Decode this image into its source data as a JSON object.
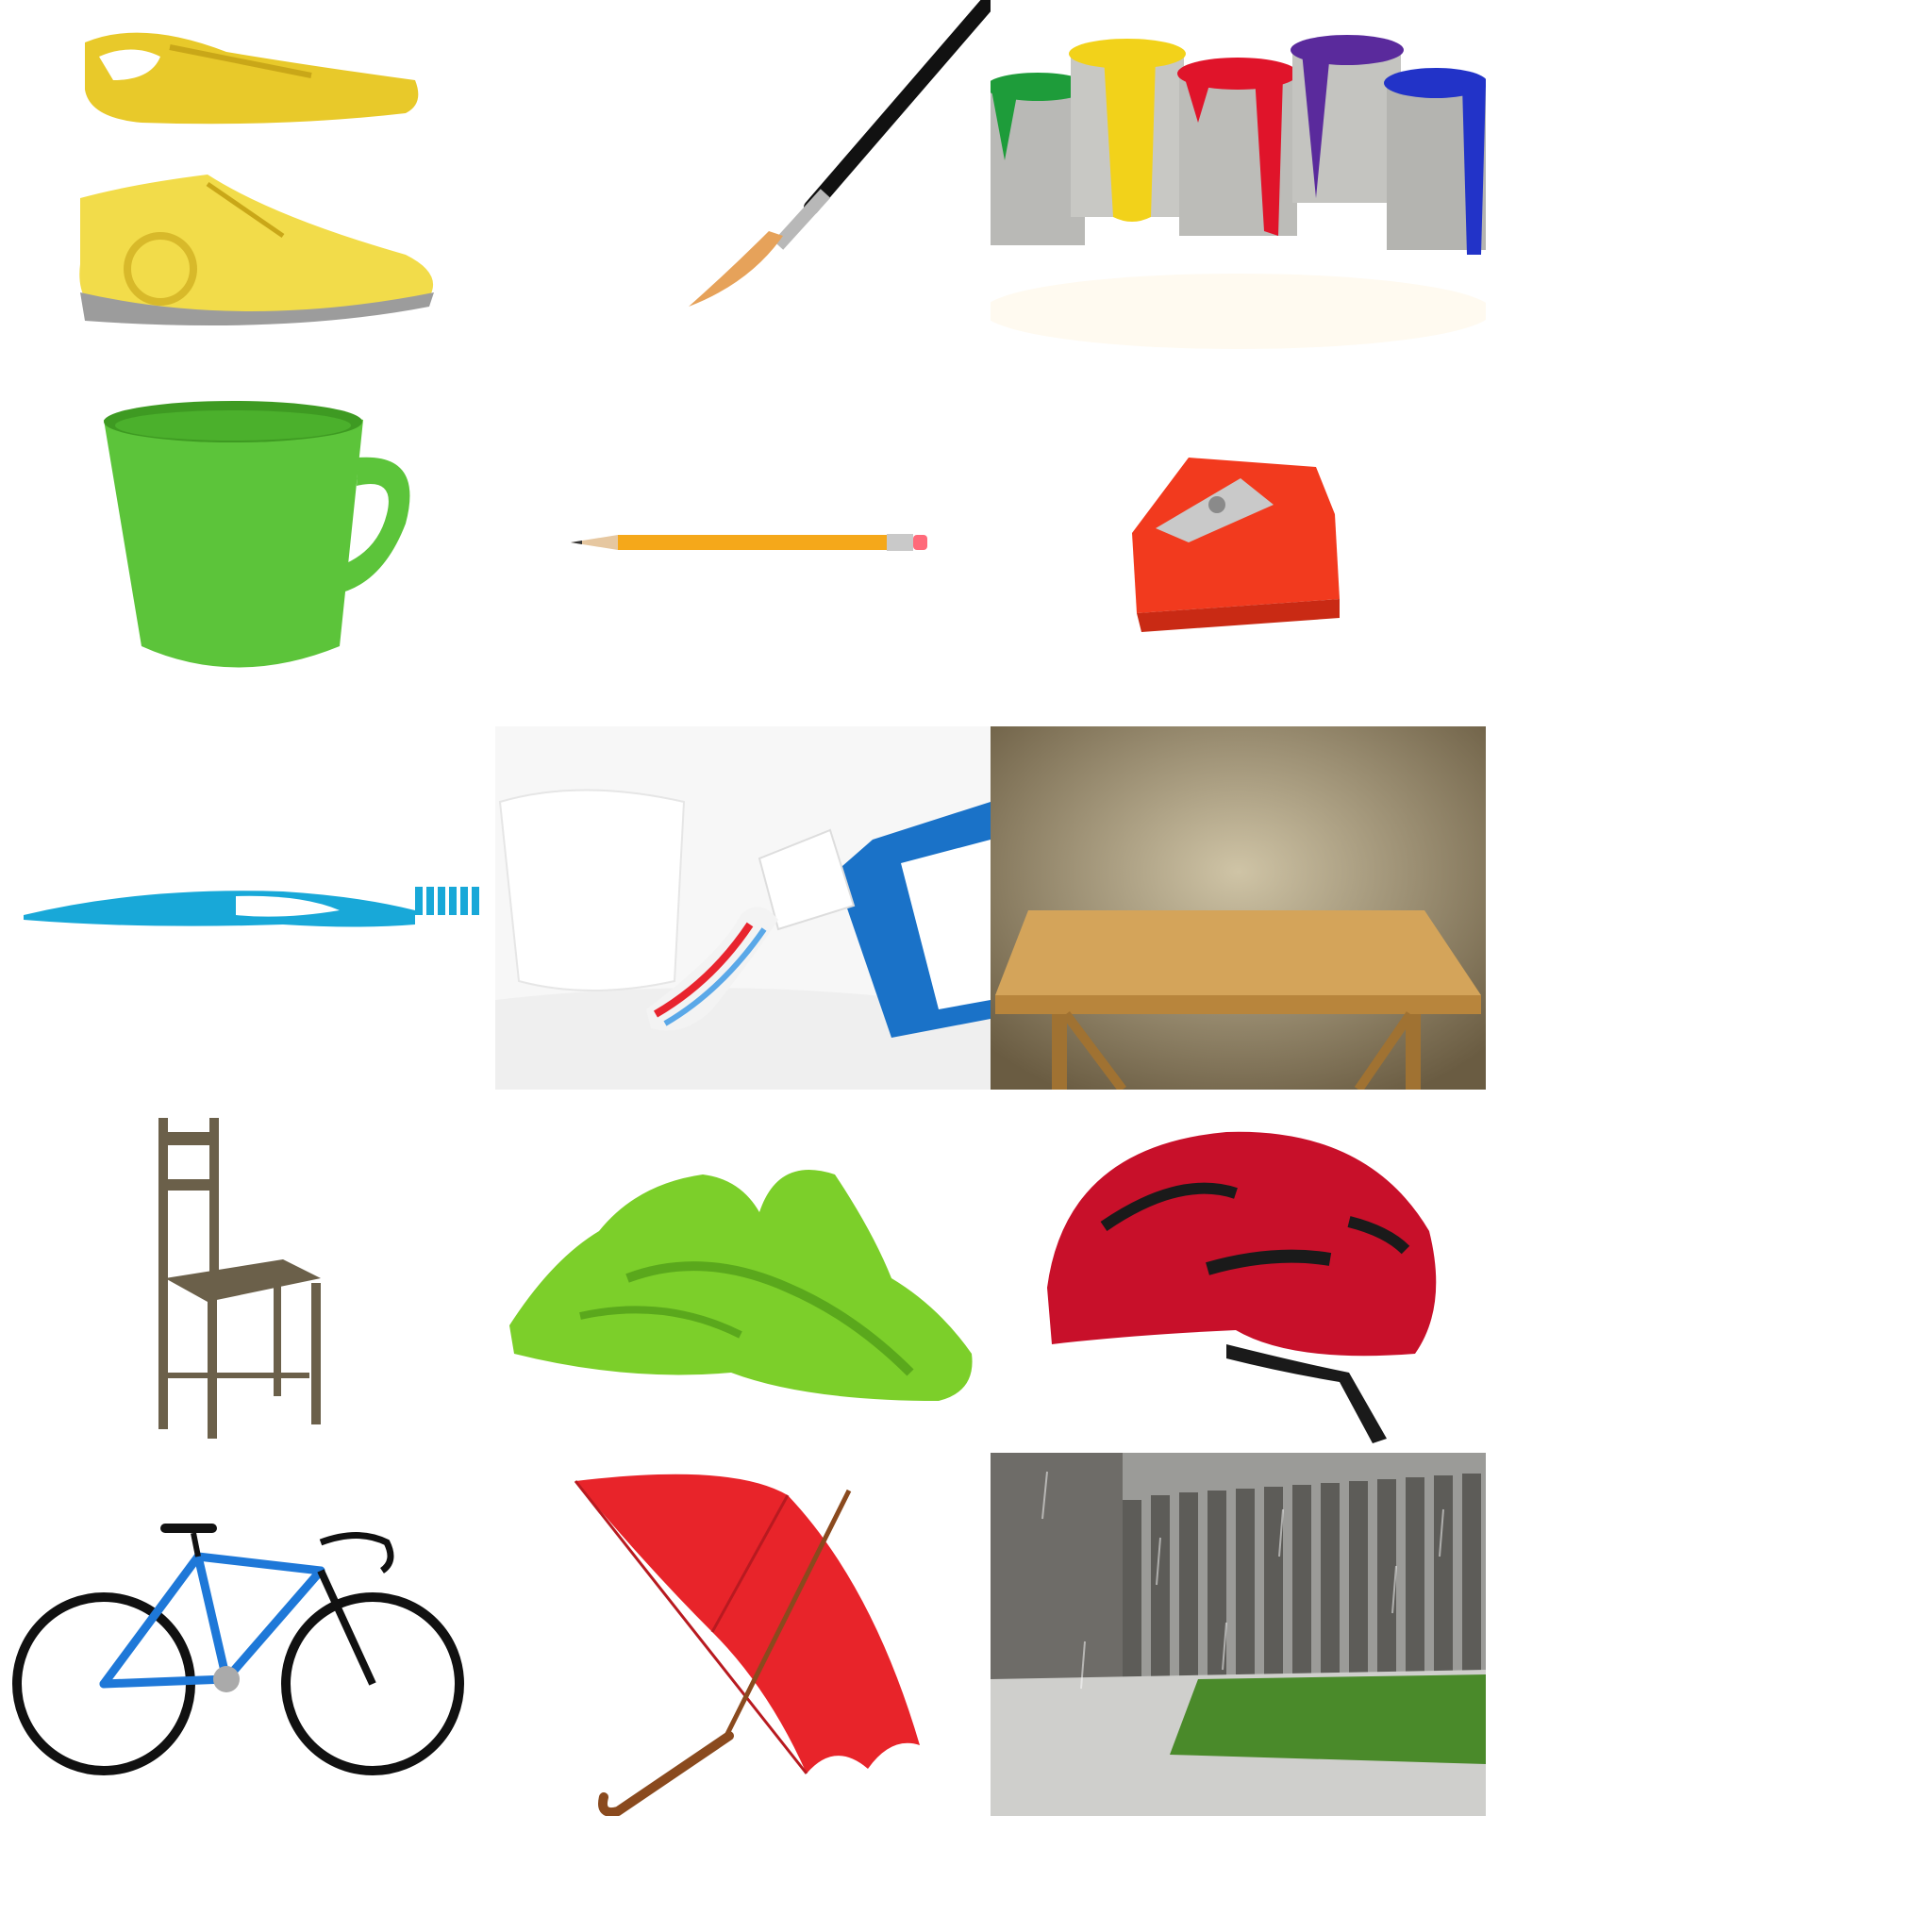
{
  "title": "",
  "grid": {
    "rows": 5,
    "cols": 3,
    "items": [
      {
        "row": 1,
        "col": 1,
        "object": "sneakers",
        "colors": [
          "#e8c92a",
          "#f2dc4a",
          "#9c9c9c"
        ]
      },
      {
        "row": 1,
        "col": 2,
        "object": "paintbrush",
        "colors": [
          "#111111",
          "#b8b8b8",
          "#e6a25a"
        ]
      },
      {
        "row": 1,
        "col": 3,
        "object": "paint-cans",
        "colors": [
          "#1e9c3a",
          "#f2d21a",
          "#e0142a",
          "#5a2a9c",
          "#2233c8"
        ]
      },
      {
        "row": 2,
        "col": 1,
        "object": "mug",
        "colors": [
          "#5cc43a",
          "#3e9a22"
        ]
      },
      {
        "row": 2,
        "col": 2,
        "object": "pencil",
        "colors": [
          "#f5a81a",
          "#c9c9c9",
          "#ff6a7a"
        ]
      },
      {
        "row": 2,
        "col": 3,
        "object": "pencil-sharpener",
        "colors": [
          "#f23a1e",
          "#c9c9c9"
        ]
      },
      {
        "row": 3,
        "col": 1,
        "object": "toothbrush",
        "colors": [
          "#18a8d8",
          "#ffffff"
        ]
      },
      {
        "row": 3,
        "col": 2,
        "object": "toothpaste",
        "colors": [
          "#ffffff",
          "#1a72c8",
          "#e8242e"
        ]
      },
      {
        "row": 3,
        "col": 3,
        "object": "wooden-table",
        "colors": [
          "#7d6f54",
          "#d4a45a"
        ]
      },
      {
        "row": 4,
        "col": 1,
        "object": "wooden-chair",
        "colors": [
          "#6b604a"
        ]
      },
      {
        "row": 4,
        "col": 2,
        "object": "towel",
        "colors": [
          "#7ccf2a"
        ]
      },
      {
        "row": 4,
        "col": 3,
        "object": "bike-helmet",
        "colors": [
          "#c8102a",
          "#1a1a1a"
        ]
      },
      {
        "row": 5,
        "col": 1,
        "object": "bicycle",
        "colors": [
          "#1e78d8",
          "#111111"
        ]
      },
      {
        "row": 5,
        "col": 2,
        "object": "umbrella",
        "colors": [
          "#e8242a",
          "#8a4a1e"
        ]
      },
      {
        "row": 5,
        "col": 3,
        "object": "rain-in-yard",
        "colors": [
          "#8a8a86",
          "#4a8a2a"
        ]
      }
    ]
  }
}
